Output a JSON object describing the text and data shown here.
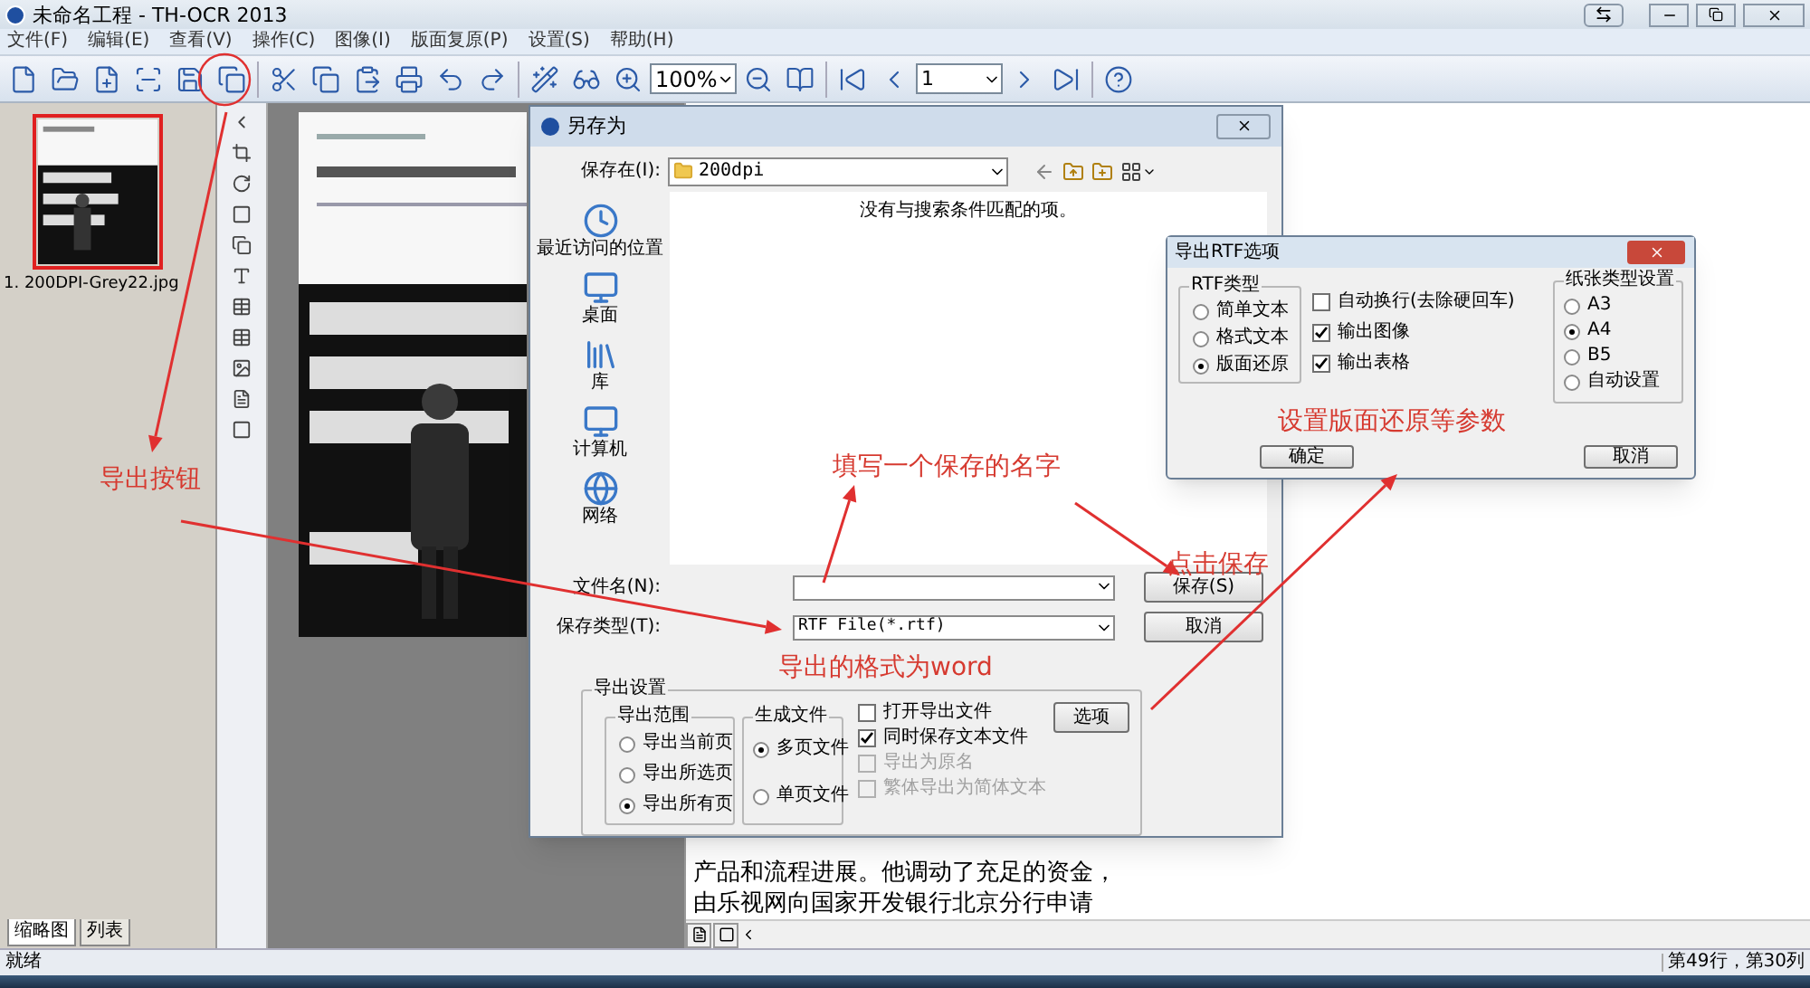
{
  "window": {
    "title": "未命名工程 - TH-OCR 2013"
  },
  "menu": [
    "文件(F)",
    "编辑(E)",
    "查看(V)",
    "操作(C)",
    "图像(I)",
    "版面复原(P)",
    "设置(S)",
    "帮助(H)"
  ],
  "toolbar": {
    "zoom": "100%",
    "page": "1"
  },
  "thumbnails": [
    {
      "caption": "1. 200DPI-Grey22.jpg",
      "selected": true
    }
  ],
  "panel_tabs": [
    {
      "label": "缩略图",
      "selected": true
    },
    {
      "label": "列表",
      "selected": false
    }
  ],
  "text_lines": [
    "产品和流程进展。他调动了充足的资金，",
    "由乐视网向国家开发银行北京分行申请"
  ],
  "status_bar": {
    "left": "就绪",
    "right": "第49行，第30列"
  },
  "save_dialog": {
    "title": "另存为",
    "save_in_label": "保存在(I):",
    "folder": "200dpi",
    "places": [
      {
        "label": "最近访问的位置",
        "kind": "recent"
      },
      {
        "label": "桌面",
        "kind": "desktop"
      },
      {
        "label": "库",
        "kind": "library"
      },
      {
        "label": "计算机",
        "kind": "computer"
      },
      {
        "label": "网络",
        "kind": "network"
      }
    ],
    "empty_message": "没有与搜索条件匹配的项。",
    "filename_label": "文件名(N):",
    "filetype_label": "保存类型(T):",
    "filetype": "RTF File(*.rtf)",
    "buttons": [
      "保存(S)",
      "取消"
    ],
    "export_group": {
      "title": "导出设置",
      "range": {
        "title": "导出范围",
        "options": [
          {
            "label": "导出当前页",
            "selected": false
          },
          {
            "label": "导出所选页",
            "selected": false
          },
          {
            "label": "导出所有页",
            "selected": true
          }
        ]
      },
      "output": {
        "title": "生成文件",
        "options": [
          {
            "label": "多页文件",
            "selected": true
          },
          {
            "label": "单页文件",
            "selected": false
          }
        ]
      },
      "checks": [
        {
          "label": "打开导出文件",
          "checked": false,
          "disabled": false
        },
        {
          "label": "同时保存文本文件",
          "checked": true,
          "disabled": false
        },
        {
          "label": "导出为原名",
          "checked": false,
          "disabled": true
        },
        {
          "label": "繁体导出为简体文本",
          "checked": false,
          "disabled": true
        }
      ],
      "options_button": "选项"
    }
  },
  "rtf_dialog": {
    "title": "导出RTF选项",
    "type_group": {
      "title": "RTF类型",
      "options": [
        {
          "label": "简单文本",
          "selected": false
        },
        {
          "label": "格式文本",
          "selected": false
        },
        {
          "label": "版面还原",
          "selected": true
        }
      ]
    },
    "checks": [
      {
        "label": "自动换行(去除硬回车)",
        "checked": false
      },
      {
        "label": "输出图像",
        "checked": true
      },
      {
        "label": "输出表格",
        "checked": true
      }
    ],
    "paper_group": {
      "title": "纸张类型设置",
      "options": [
        {
          "label": "A3",
          "selected": false
        },
        {
          "label": "A4",
          "selected": true
        },
        {
          "label": "B5",
          "selected": false
        },
        {
          "label": "自动设置",
          "selected": false
        }
      ]
    },
    "buttons": [
      "确定",
      "取消"
    ]
  },
  "annotations": [
    "导出按钮",
    "填写一个保存的名字",
    "点击保存",
    "导出的格式为word",
    "设置版面还原等参数"
  ]
}
